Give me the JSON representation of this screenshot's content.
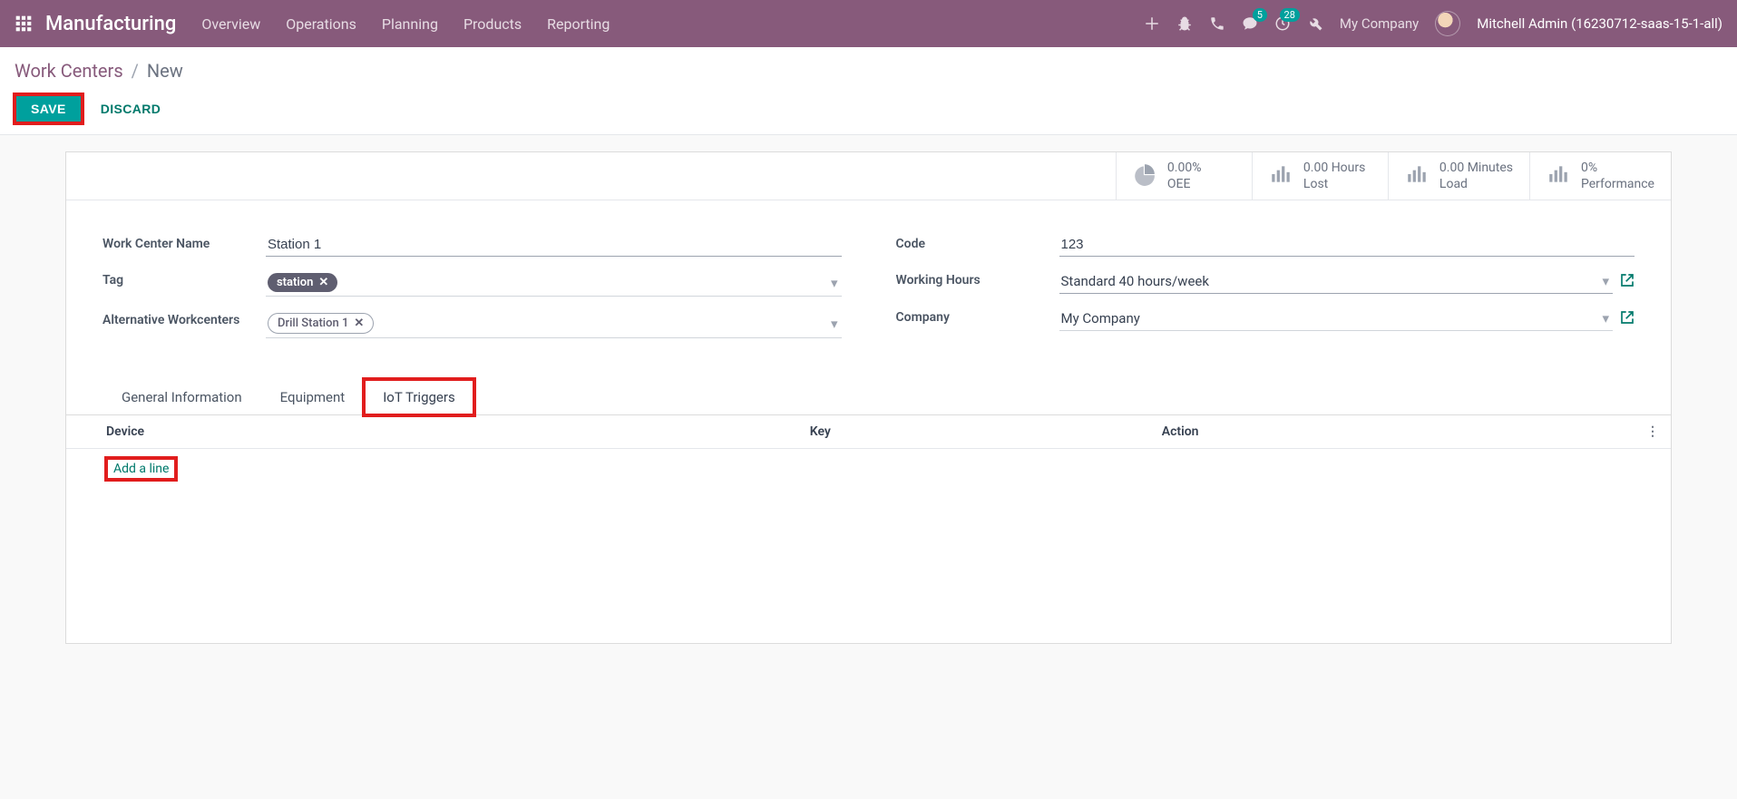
{
  "nav": {
    "appname": "Manufacturing",
    "menu": [
      "Overview",
      "Operations",
      "Planning",
      "Products",
      "Reporting"
    ],
    "badges": {
      "messages": "5",
      "activities": "28"
    },
    "company": "My Company",
    "username": "Mitchell Admin (16230712-saas-15-1-all)"
  },
  "breadcrumb": {
    "parent": "Work Centers",
    "current": "New"
  },
  "actions": {
    "save": "SAVE",
    "discard": "DISCARD"
  },
  "stats": {
    "oee": {
      "value": "0.00%",
      "label": "OEE"
    },
    "lost": {
      "value": "0.00 Hours",
      "label": "Lost"
    },
    "load": {
      "value": "0.00 Minutes",
      "label": "Load"
    },
    "perf": {
      "value": "0%",
      "label": "Performance"
    }
  },
  "form": {
    "name_label": "Work Center Name",
    "name_value": "Station 1",
    "tag_label": "Tag",
    "tag_value": "station",
    "alt_label": "Alternative Workcenters",
    "alt_value": "Drill Station 1",
    "code_label": "Code",
    "code_value": "123",
    "hours_label": "Working Hours",
    "hours_value": "Standard 40 hours/week",
    "company_label": "Company",
    "company_value": "My Company"
  },
  "tabs": {
    "general": "General Information",
    "equipment": "Equipment",
    "iot": "IoT Triggers"
  },
  "table": {
    "col_device": "Device",
    "col_key": "Key",
    "col_action": "Action",
    "add_line": "Add a line"
  }
}
